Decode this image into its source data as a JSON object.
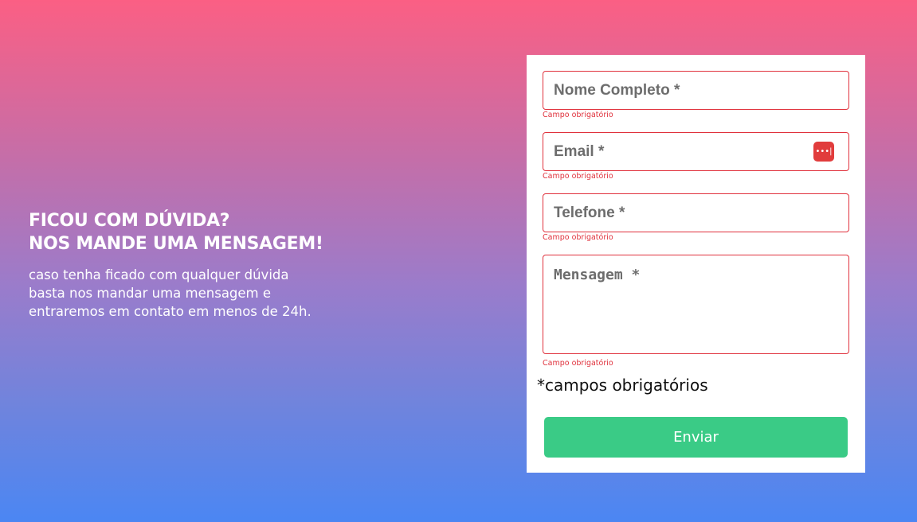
{
  "hero": {
    "title_line1": "FICOU COM DÚVIDA?",
    "title_line2": "NOS MANDE UMA MENSAGEM!",
    "description": "caso tenha ficado com qualquer dúvida basta nos mandar uma mensagem e entraremos em contato em menos de 24h."
  },
  "form": {
    "name": {
      "placeholder": "Nome Completo *",
      "value": "",
      "error": "Campo obrigatório"
    },
    "email": {
      "placeholder": "Email *",
      "value": "",
      "error": "Campo obrigatório",
      "icon": "password-manager-icon"
    },
    "phone": {
      "placeholder": "Telefone *",
      "value": "",
      "error": "Campo obrigatório"
    },
    "message": {
      "placeholder": "Mensagem *",
      "value": "",
      "error": "Campo obrigatório"
    },
    "required_note": "*campos obrigatórios",
    "submit_label": "Enviar"
  },
  "colors": {
    "gradient_top": "#fb5f84",
    "gradient_bottom": "#4b86f3",
    "error": "#e0323d",
    "submit": "#3acb86"
  }
}
